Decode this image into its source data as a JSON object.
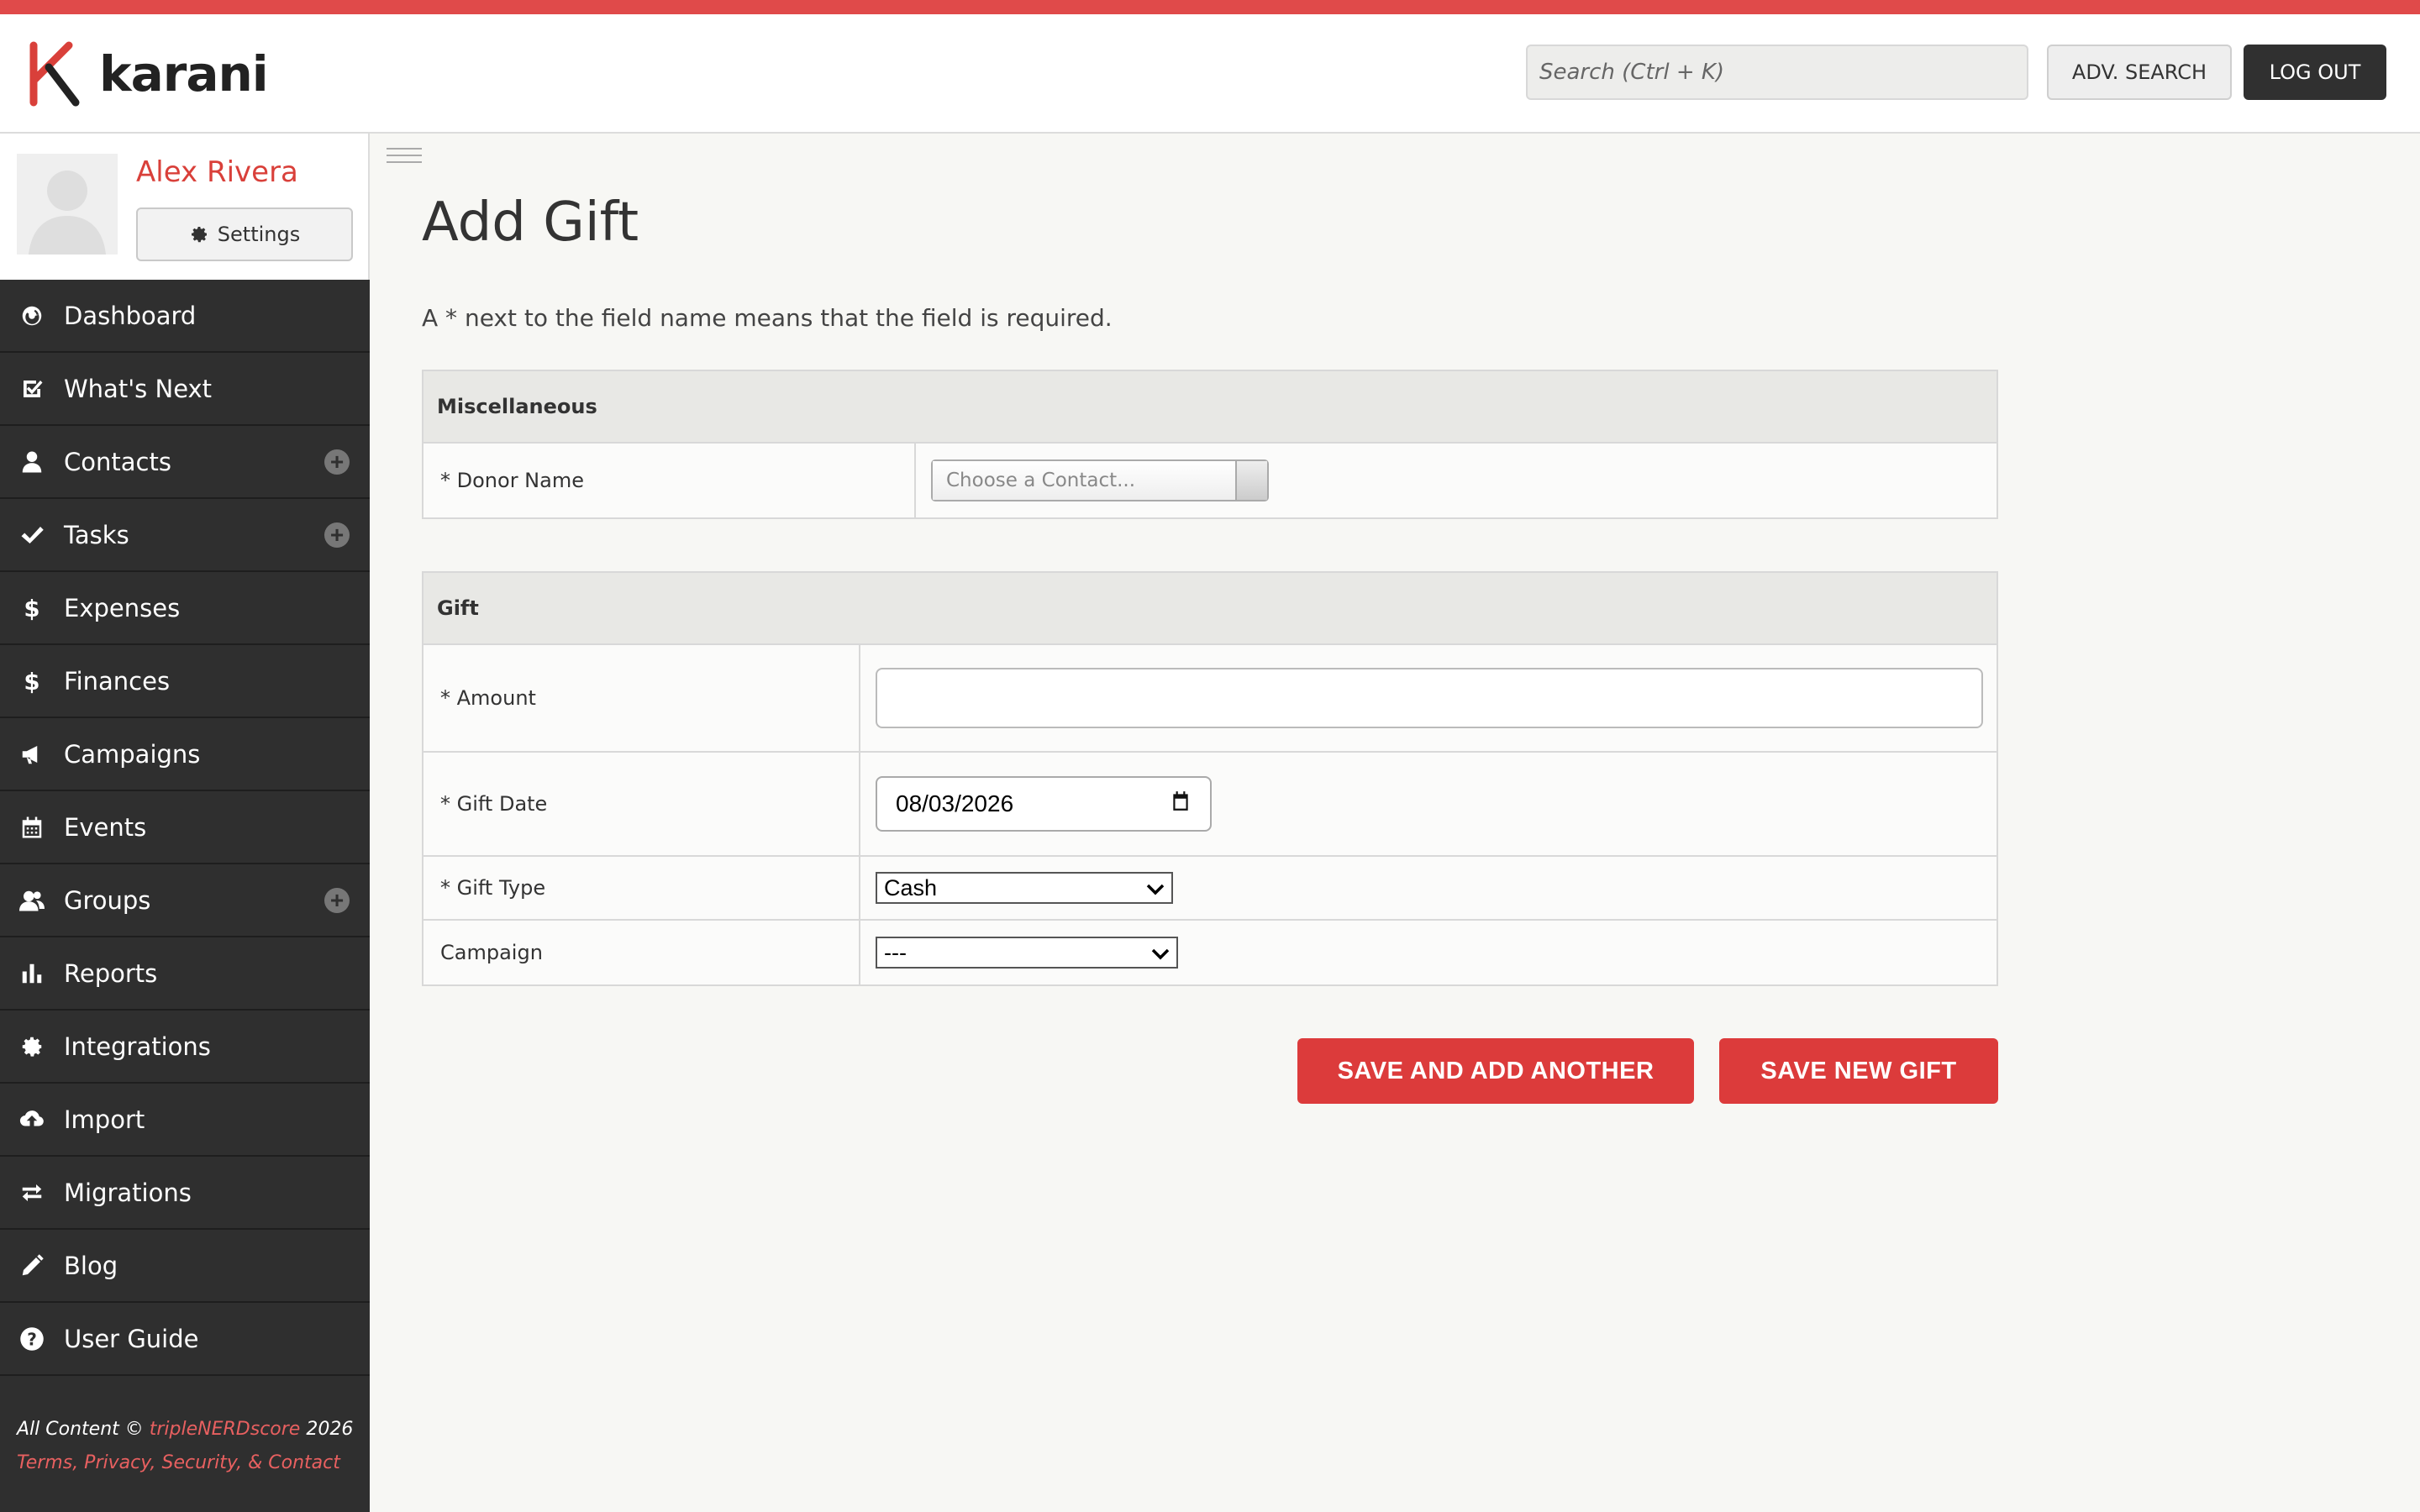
{
  "app": {
    "logo_text": "karani"
  },
  "header": {
    "search_placeholder": "Search (Ctrl + K)",
    "adv_search_label": "ADV. SEARCH",
    "logout_label": "LOG OUT"
  },
  "profile": {
    "name": "Alex Rivera",
    "settings_label": "Settings"
  },
  "sidebar": {
    "items": [
      {
        "label": "Dashboard",
        "icon": "dashboard-icon",
        "has_add": false
      },
      {
        "label": "What's Next",
        "icon": "checkbox-icon",
        "has_add": false
      },
      {
        "label": "Contacts",
        "icon": "person-icon",
        "has_add": true
      },
      {
        "label": "Tasks",
        "icon": "check-icon",
        "has_add": true
      },
      {
        "label": "Expenses",
        "icon": "dollar-icon",
        "has_add": false
      },
      {
        "label": "Finances",
        "icon": "dollar-icon",
        "has_add": false
      },
      {
        "label": "Campaigns",
        "icon": "megaphone-icon",
        "has_add": false
      },
      {
        "label": "Events",
        "icon": "calendar-icon",
        "has_add": false
      },
      {
        "label": "Groups",
        "icon": "group-icon",
        "has_add": true
      },
      {
        "label": "Reports",
        "icon": "bar-chart-icon",
        "has_add": false
      },
      {
        "label": "Integrations",
        "icon": "gear-icon",
        "has_add": false
      },
      {
        "label": "Import",
        "icon": "cloud-upload-icon",
        "has_add": false
      },
      {
        "label": "Migrations",
        "icon": "arrows-icon",
        "has_add": false
      },
      {
        "label": "Blog",
        "icon": "pencil-icon",
        "has_add": false
      },
      {
        "label": "User Guide",
        "icon": "question-icon",
        "has_add": false
      }
    ],
    "footer": {
      "prefix": "All Content © ",
      "brand": "tripleNERDscore",
      "year": " 2026",
      "links": "Terms, Privacy, Security, & Contact"
    }
  },
  "main": {
    "title": "Add Gift",
    "note": "A * next to the field name means that the field is required.",
    "misc_section": {
      "heading": "Miscellaneous",
      "donor_label": "* Donor Name",
      "donor_placeholder": "Choose a Contact..."
    },
    "gift_section": {
      "heading": "Gift",
      "amount_label": "* Amount",
      "amount_value": "",
      "gift_date_label": "* Gift Date",
      "gift_date_value": "08/03/2026",
      "gift_type_label": "* Gift Type",
      "gift_type_value": "Cash",
      "campaign_label": "Campaign",
      "campaign_value": "---"
    },
    "buttons": {
      "save_add_another": "SAVE AND ADD ANOTHER",
      "save_new_gift": "SAVE NEW GIFT"
    }
  },
  "colors": {
    "accent": "#dc3b3b",
    "sidebar_bg": "#2f2f2f",
    "profile_name": "#d9403a"
  }
}
